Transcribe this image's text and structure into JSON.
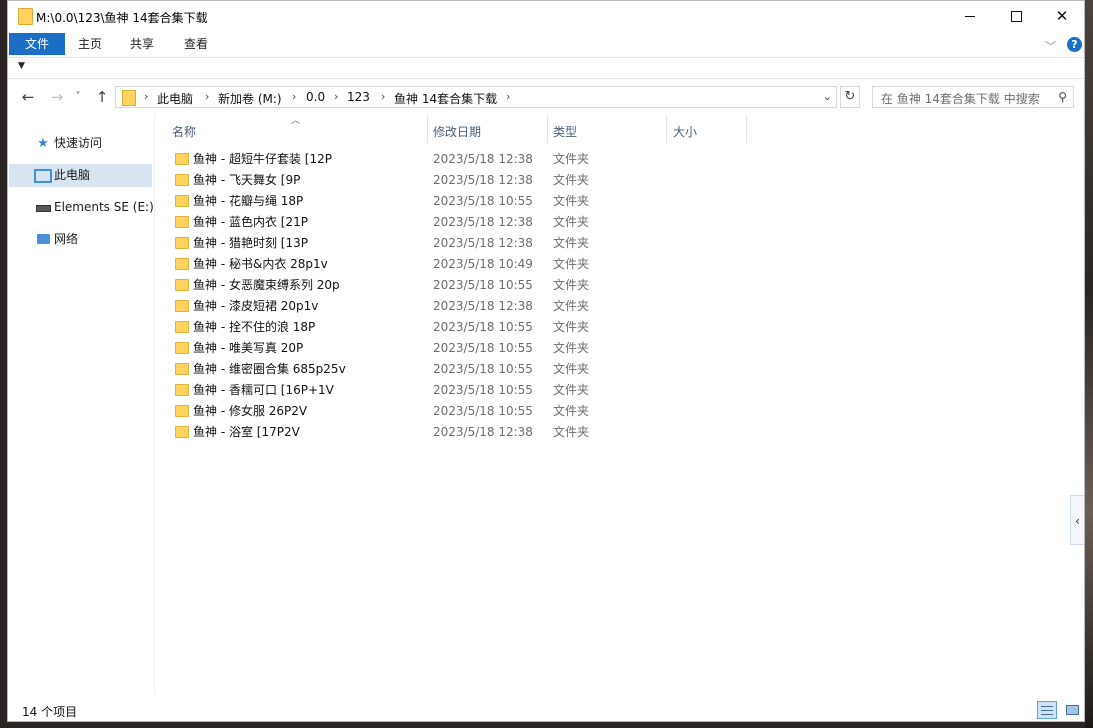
{
  "window": {
    "title": "M:\\0.0\\123\\鱼神 14套合集下载"
  },
  "ribbon": {
    "tabs": [
      "文件",
      "主页",
      "共享",
      "查看"
    ],
    "help_label": "?"
  },
  "address": {
    "crumbs": [
      "此电脑",
      "新加卷 (M:)",
      "0.0",
      "123",
      "鱼神 14套合集下载"
    ]
  },
  "search": {
    "placeholder": "在 鱼神 14套合集下载 中搜索"
  },
  "sidebar": {
    "items": [
      {
        "label": "快速访问",
        "icon": "star-icon"
      },
      {
        "label": "此电脑",
        "icon": "computer-icon",
        "selected": true
      },
      {
        "label": "Elements SE (E:)",
        "icon": "drive-icon"
      },
      {
        "label": "网络",
        "icon": "network-icon"
      }
    ]
  },
  "columns": [
    "名称",
    "修改日期",
    "类型",
    "大小"
  ],
  "files": [
    {
      "name": "鱼神 - 超短牛仔套装 [12P",
      "date": "2023/5/18 12:38",
      "type": "文件夹"
    },
    {
      "name": "鱼神 - 飞天舞女 [9P",
      "date": "2023/5/18 12:38",
      "type": "文件夹"
    },
    {
      "name": "鱼神 - 花瓣与绳 18P",
      "date": "2023/5/18 10:55",
      "type": "文件夹"
    },
    {
      "name": "鱼神 - 蓝色内衣 [21P",
      "date": "2023/5/18 12:38",
      "type": "文件夹"
    },
    {
      "name": "鱼神 - 猎艳时刻 [13P",
      "date": "2023/5/18 12:38",
      "type": "文件夹"
    },
    {
      "name": "鱼神 - 秘书&内衣 28p1v",
      "date": "2023/5/18 10:49",
      "type": "文件夹"
    },
    {
      "name": "鱼神 - 女恶魔束缚系列 20p",
      "date": "2023/5/18 10:55",
      "type": "文件夹"
    },
    {
      "name": "鱼神 - 漆皮短裙 20p1v",
      "date": "2023/5/18 12:38",
      "type": "文件夹"
    },
    {
      "name": "鱼神 - 拴不住的浪 18P",
      "date": "2023/5/18 10:55",
      "type": "文件夹"
    },
    {
      "name": "鱼神 - 唯美写真 20P",
      "date": "2023/5/18 10:55",
      "type": "文件夹"
    },
    {
      "name": "鱼神 - 维密圈合集 685p25v",
      "date": "2023/5/18 10:55",
      "type": "文件夹"
    },
    {
      "name": "鱼神 - 香糯可口 [16P+1V",
      "date": "2023/5/18 10:55",
      "type": "文件夹"
    },
    {
      "name": "鱼神 - 修女服 26P2V",
      "date": "2023/5/18 10:55",
      "type": "文件夹"
    },
    {
      "name": "鱼神 - 浴室 [17P2V",
      "date": "2023/5/18 12:38",
      "type": "文件夹"
    }
  ],
  "status": {
    "count_text": "14 个项目"
  },
  "colors": {
    "accent": "#1a6fc4",
    "folder": "#ffd35c",
    "selection": "#d9e4f1"
  }
}
